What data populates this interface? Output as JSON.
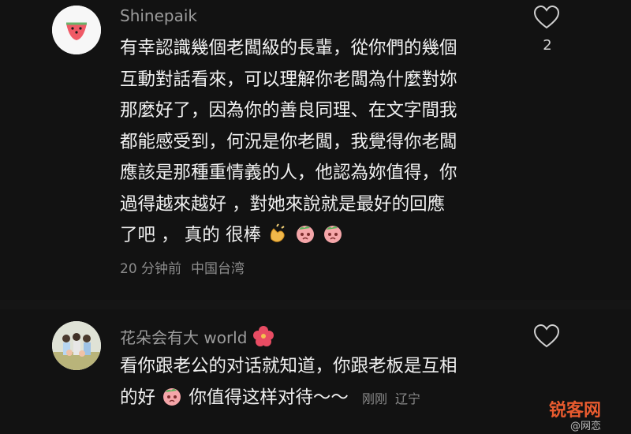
{
  "comments": [
    {
      "username": "Shinepaik",
      "avatar_icon": "watermelon-icon",
      "lines": [
        "有幸認識幾個老闆級的長輩，從你們的幾個",
        "互動對話看來，可以理解你老闆為什麼對妳",
        "那麼好了，因為你的善良同理、在文字間我",
        "都能感受到，何況是你老闆，我覺得你老闆",
        "應該是那種重情義的人，他認為妳值得，你",
        "過得越來越好 ，對她來說就是最好的回應",
        "了吧 ， 真的 很棒"
      ],
      "time": "20 分钟前",
      "location": "中国台湾",
      "like_count": "2"
    },
    {
      "username": "花朵会有大 world",
      "avatar_icon": "group-photo-avatar",
      "lines": [
        "看你跟老公的对话就知道，你跟老板是互相",
        "的好",
        "你值得这样对待～～"
      ],
      "time": "刚刚",
      "location": "辽宁"
    }
  ],
  "watermark": {
    "brand": "锐客网",
    "handle": "@网恋"
  }
}
